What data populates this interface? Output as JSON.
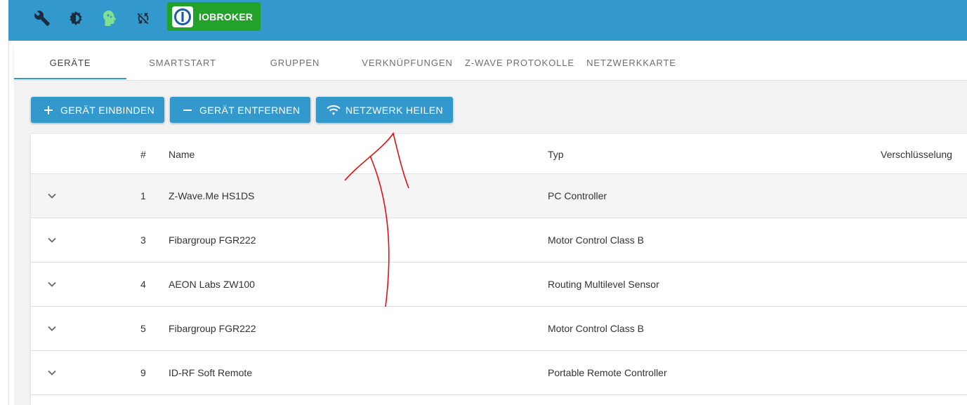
{
  "topbar": {
    "icons": [
      "wrench-icon",
      "settings-icon",
      "head-icon",
      "sync-off-icon"
    ],
    "brand": {
      "name": "IOBROKER",
      "color": "#22a22b"
    },
    "color": "#3399cc"
  },
  "tabs": [
    {
      "label": "GERÄTE",
      "active": true
    },
    {
      "label": "SMARTSTART",
      "active": false
    },
    {
      "label": "GRUPPEN",
      "active": false
    },
    {
      "label": "VERKNÜPFUNGEN",
      "active": false
    },
    {
      "label": "Z-WAVE PROTOKOLLE",
      "active": false
    },
    {
      "label": "NETZWERKKARTE",
      "active": false
    }
  ],
  "toolbar": {
    "include_label": "GERÄT EINBINDEN",
    "remove_label": "GERÄT ENTFERNEN",
    "heal_label": "NETZWERK HEILEN"
  },
  "table": {
    "headers": {
      "id": "#",
      "name": "Name",
      "type": "Typ",
      "encryption": "Verschlüsselung"
    },
    "rows": [
      {
        "id": "1",
        "name": "Z-Wave.Me HS1DS",
        "type": "PC Controller"
      },
      {
        "id": "3",
        "name": "Fibargroup FGR222",
        "type": "Motor Control Class B"
      },
      {
        "id": "4",
        "name": "AEON Labs ZW100",
        "type": "Routing Multilevel Sensor"
      },
      {
        "id": "5",
        "name": "Fibargroup FGR222",
        "type": "Motor Control Class B"
      },
      {
        "id": "9",
        "name": "ID-RF Soft Remote",
        "type": "Portable Remote Controller"
      }
    ]
  },
  "annotation": {
    "color": "#e01010",
    "icon": "red-arrow-annotation"
  }
}
